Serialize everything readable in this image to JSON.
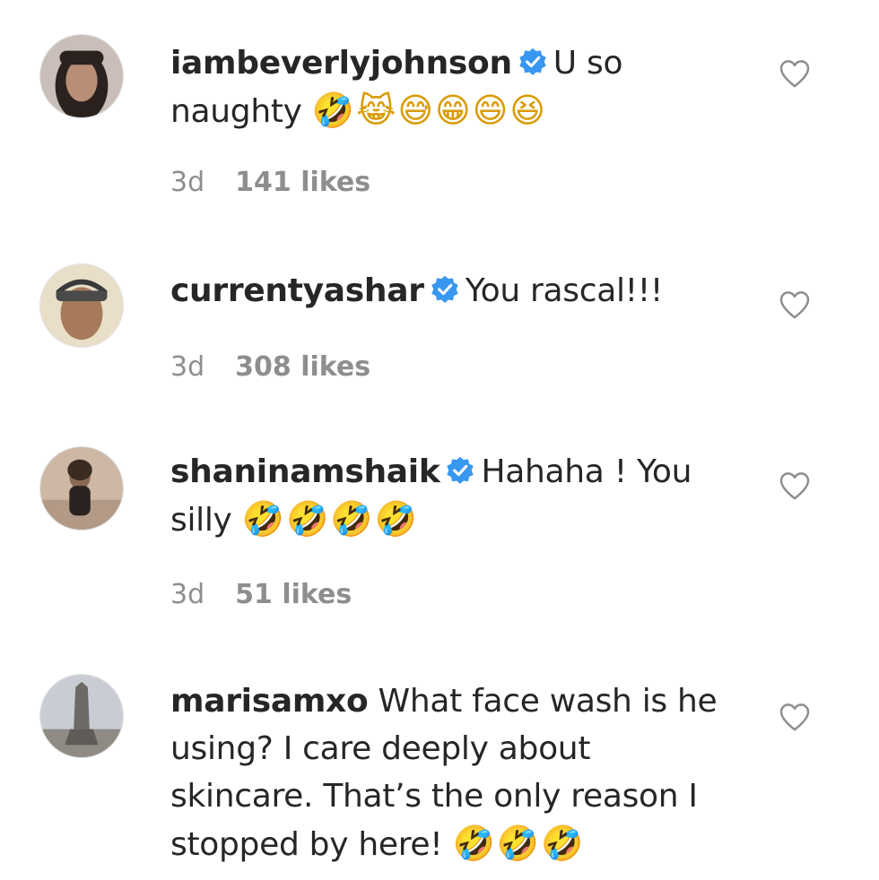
{
  "comments": [
    {
      "username": "iambeverlyjohnson",
      "verified": true,
      "text": "U so naughty",
      "emojis": "🤣😹😅😁😄😆",
      "time": "3d",
      "likes": "141 likes",
      "avatar_icon": "user-avatar-icon"
    },
    {
      "username": "currentyashar",
      "verified": true,
      "text": "You rascal!!!",
      "emojis": "",
      "time": "3d",
      "likes": "308 likes",
      "avatar_icon": "user-avatar-icon"
    },
    {
      "username": "shaninamshaik",
      "verified": true,
      "text": "Hahaha ! You silly",
      "emojis": "🤣🤣🤣🤣",
      "time": "3d",
      "likes": "51 likes",
      "avatar_icon": "user-avatar-icon"
    },
    {
      "username": "marisamxo",
      "verified": false,
      "text": "What face wash is he using? I care deeply about skincare. That’s the only reason I stopped by here!",
      "emojis": "🤣🤣🤣",
      "time": "",
      "likes": "",
      "avatar_icon": "user-avatar-icon"
    }
  ],
  "colors": {
    "verified_badge": "#3897f0",
    "text": "#262626",
    "meta": "#8e8e8e",
    "heart_outline": "#8e8e8e"
  },
  "icons": {
    "verified": "verified-badge-icon",
    "like": "heart-icon"
  }
}
